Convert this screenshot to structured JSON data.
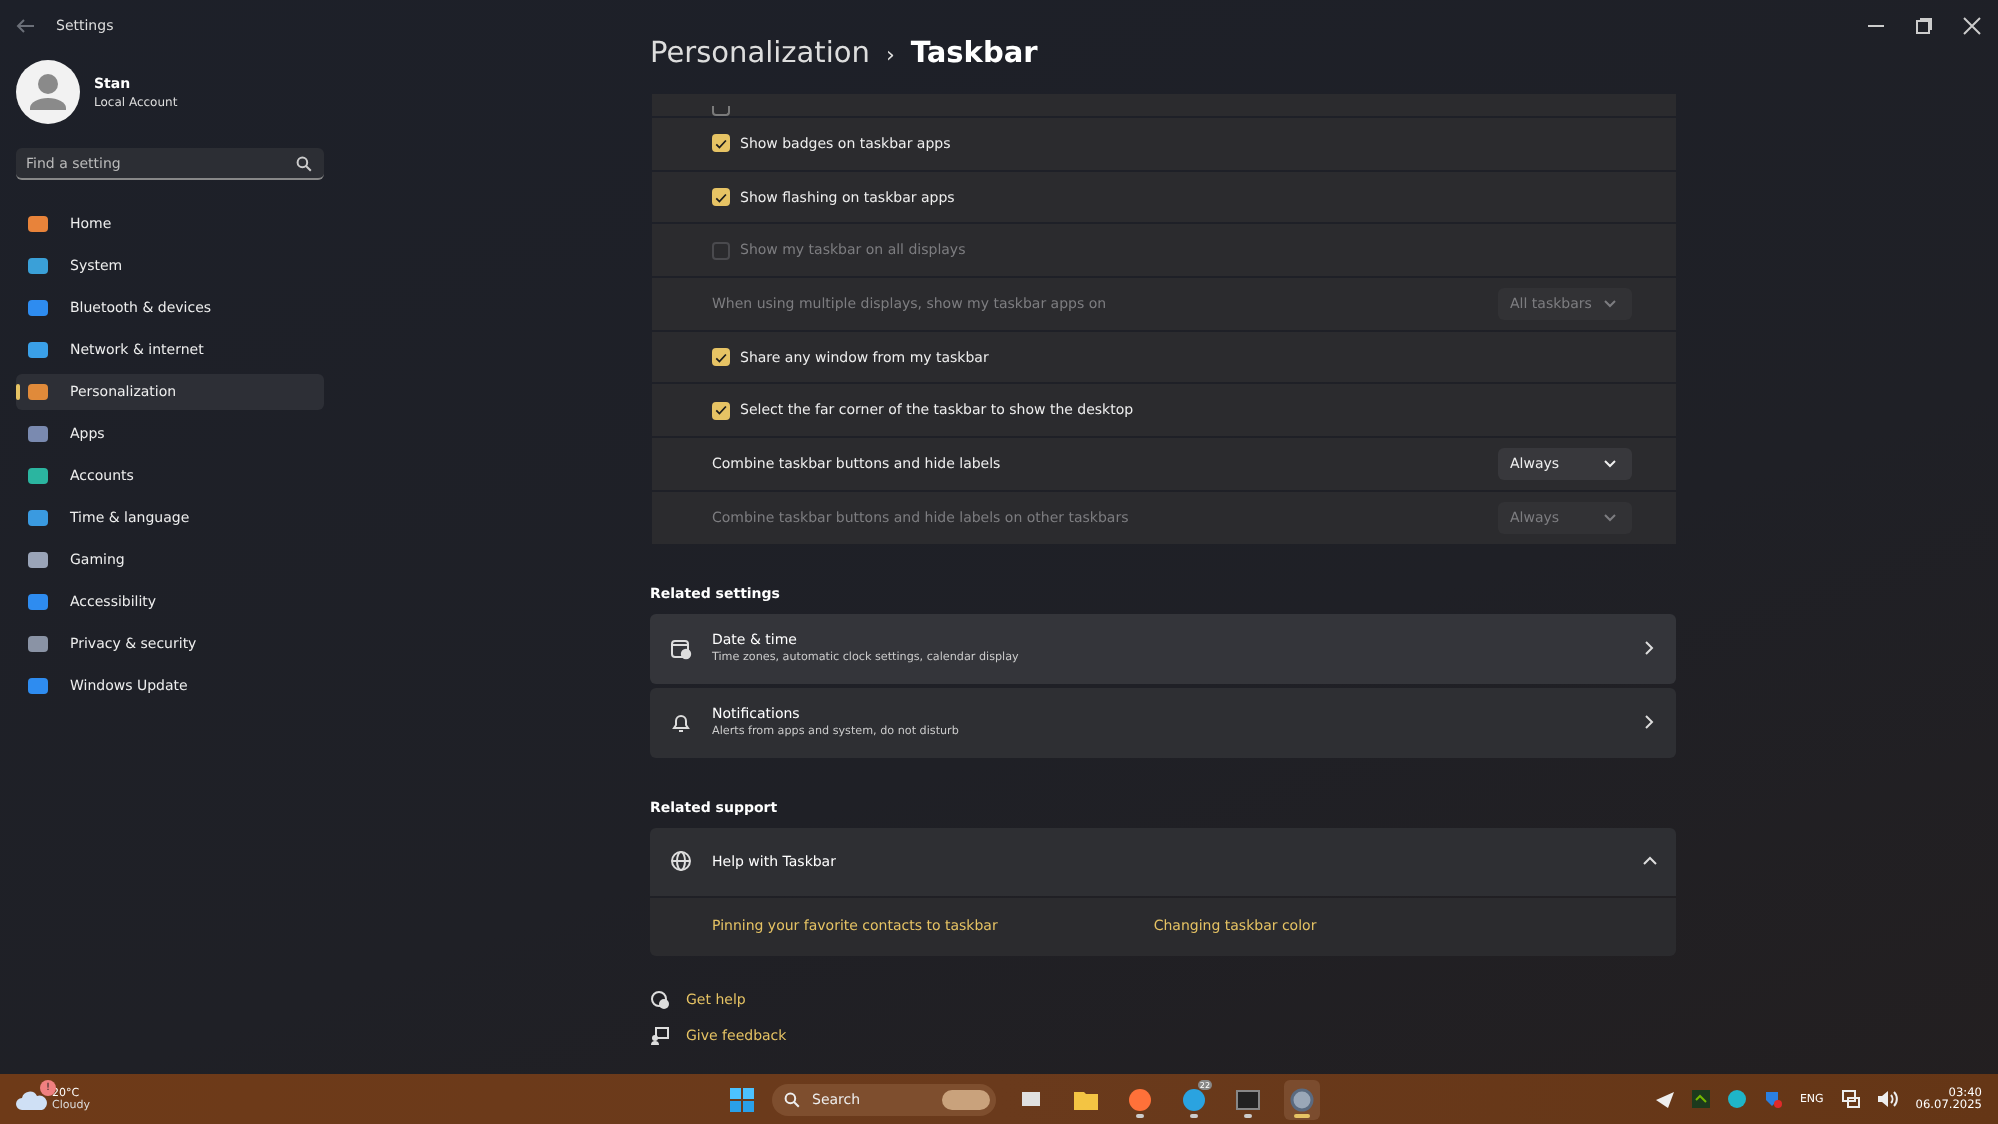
{
  "window": {
    "title": "Settings"
  },
  "user": {
    "name": "Stan",
    "account": "Local Account"
  },
  "search": {
    "placeholder": "Find a setting"
  },
  "sidebar": {
    "items": [
      {
        "label": "Home",
        "selected": false
      },
      {
        "label": "System",
        "selected": false
      },
      {
        "label": "Bluetooth & devices",
        "selected": false
      },
      {
        "label": "Network & internet",
        "selected": false
      },
      {
        "label": "Personalization",
        "selected": true
      },
      {
        "label": "Apps",
        "selected": false
      },
      {
        "label": "Accounts",
        "selected": false
      },
      {
        "label": "Time & language",
        "selected": false
      },
      {
        "label": "Gaming",
        "selected": false
      },
      {
        "label": "Accessibility",
        "selected": false
      },
      {
        "label": "Privacy & security",
        "selected": false
      },
      {
        "label": "Windows Update",
        "selected": false
      }
    ]
  },
  "breadcrumb": {
    "parent": "Personalization",
    "separator": "›",
    "current": "Taskbar"
  },
  "behaviors": [
    {
      "kind": "checkbox",
      "checked": false,
      "disabled": false
    },
    {
      "kind": "checkbox",
      "label": "Show badges on taskbar apps",
      "checked": true,
      "disabled": false
    },
    {
      "kind": "checkbox",
      "label": "Show flashing on taskbar apps",
      "checked": true,
      "disabled": false
    },
    {
      "kind": "checkbox",
      "label": "Show my taskbar on all displays",
      "checked": false,
      "disabled": true
    },
    {
      "kind": "dropdown",
      "label": "When using multiple displays, show my taskbar apps on",
      "value": "All taskbars",
      "disabled": true
    },
    {
      "kind": "checkbox",
      "label": "Share any window from my taskbar",
      "checked": true,
      "disabled": false
    },
    {
      "kind": "checkbox",
      "label": "Select the far corner of the taskbar to show the desktop",
      "checked": true,
      "disabled": false
    },
    {
      "kind": "dropdown",
      "label": "Combine taskbar buttons and hide labels",
      "value": "Always",
      "disabled": false
    },
    {
      "kind": "dropdown",
      "label": "Combine taskbar buttons and hide labels on other taskbars",
      "value": "Always",
      "disabled": true
    }
  ],
  "related_settings": {
    "heading": "Related settings",
    "items": [
      {
        "title": "Date & time",
        "description": "Time zones, automatic clock settings, calendar display"
      },
      {
        "title": "Notifications",
        "description": "Alerts from apps and system, do not disturb"
      }
    ]
  },
  "related_support": {
    "heading": "Related support",
    "title": "Help with Taskbar",
    "expanded": true,
    "links": [
      "Pinning your favorite contacts to taskbar",
      "Changing taskbar color"
    ]
  },
  "footer_links": [
    "Get help",
    "Give feedback"
  ],
  "taskbar": {
    "weather": {
      "temperature": "20°C",
      "condition": "Cloudy",
      "badge": "!"
    },
    "search": "Search",
    "apps": [
      {
        "running": false,
        "selected": false
      },
      {
        "running": false,
        "selected": false
      },
      {
        "running": true,
        "selected": false
      },
      {
        "running": true,
        "selected": false,
        "badge": "22"
      },
      {
        "running": true,
        "selected": false
      },
      {
        "running": true,
        "selected": true
      }
    ],
    "language": "ENG",
    "time": "03:40",
    "date": "06.07.2025"
  }
}
